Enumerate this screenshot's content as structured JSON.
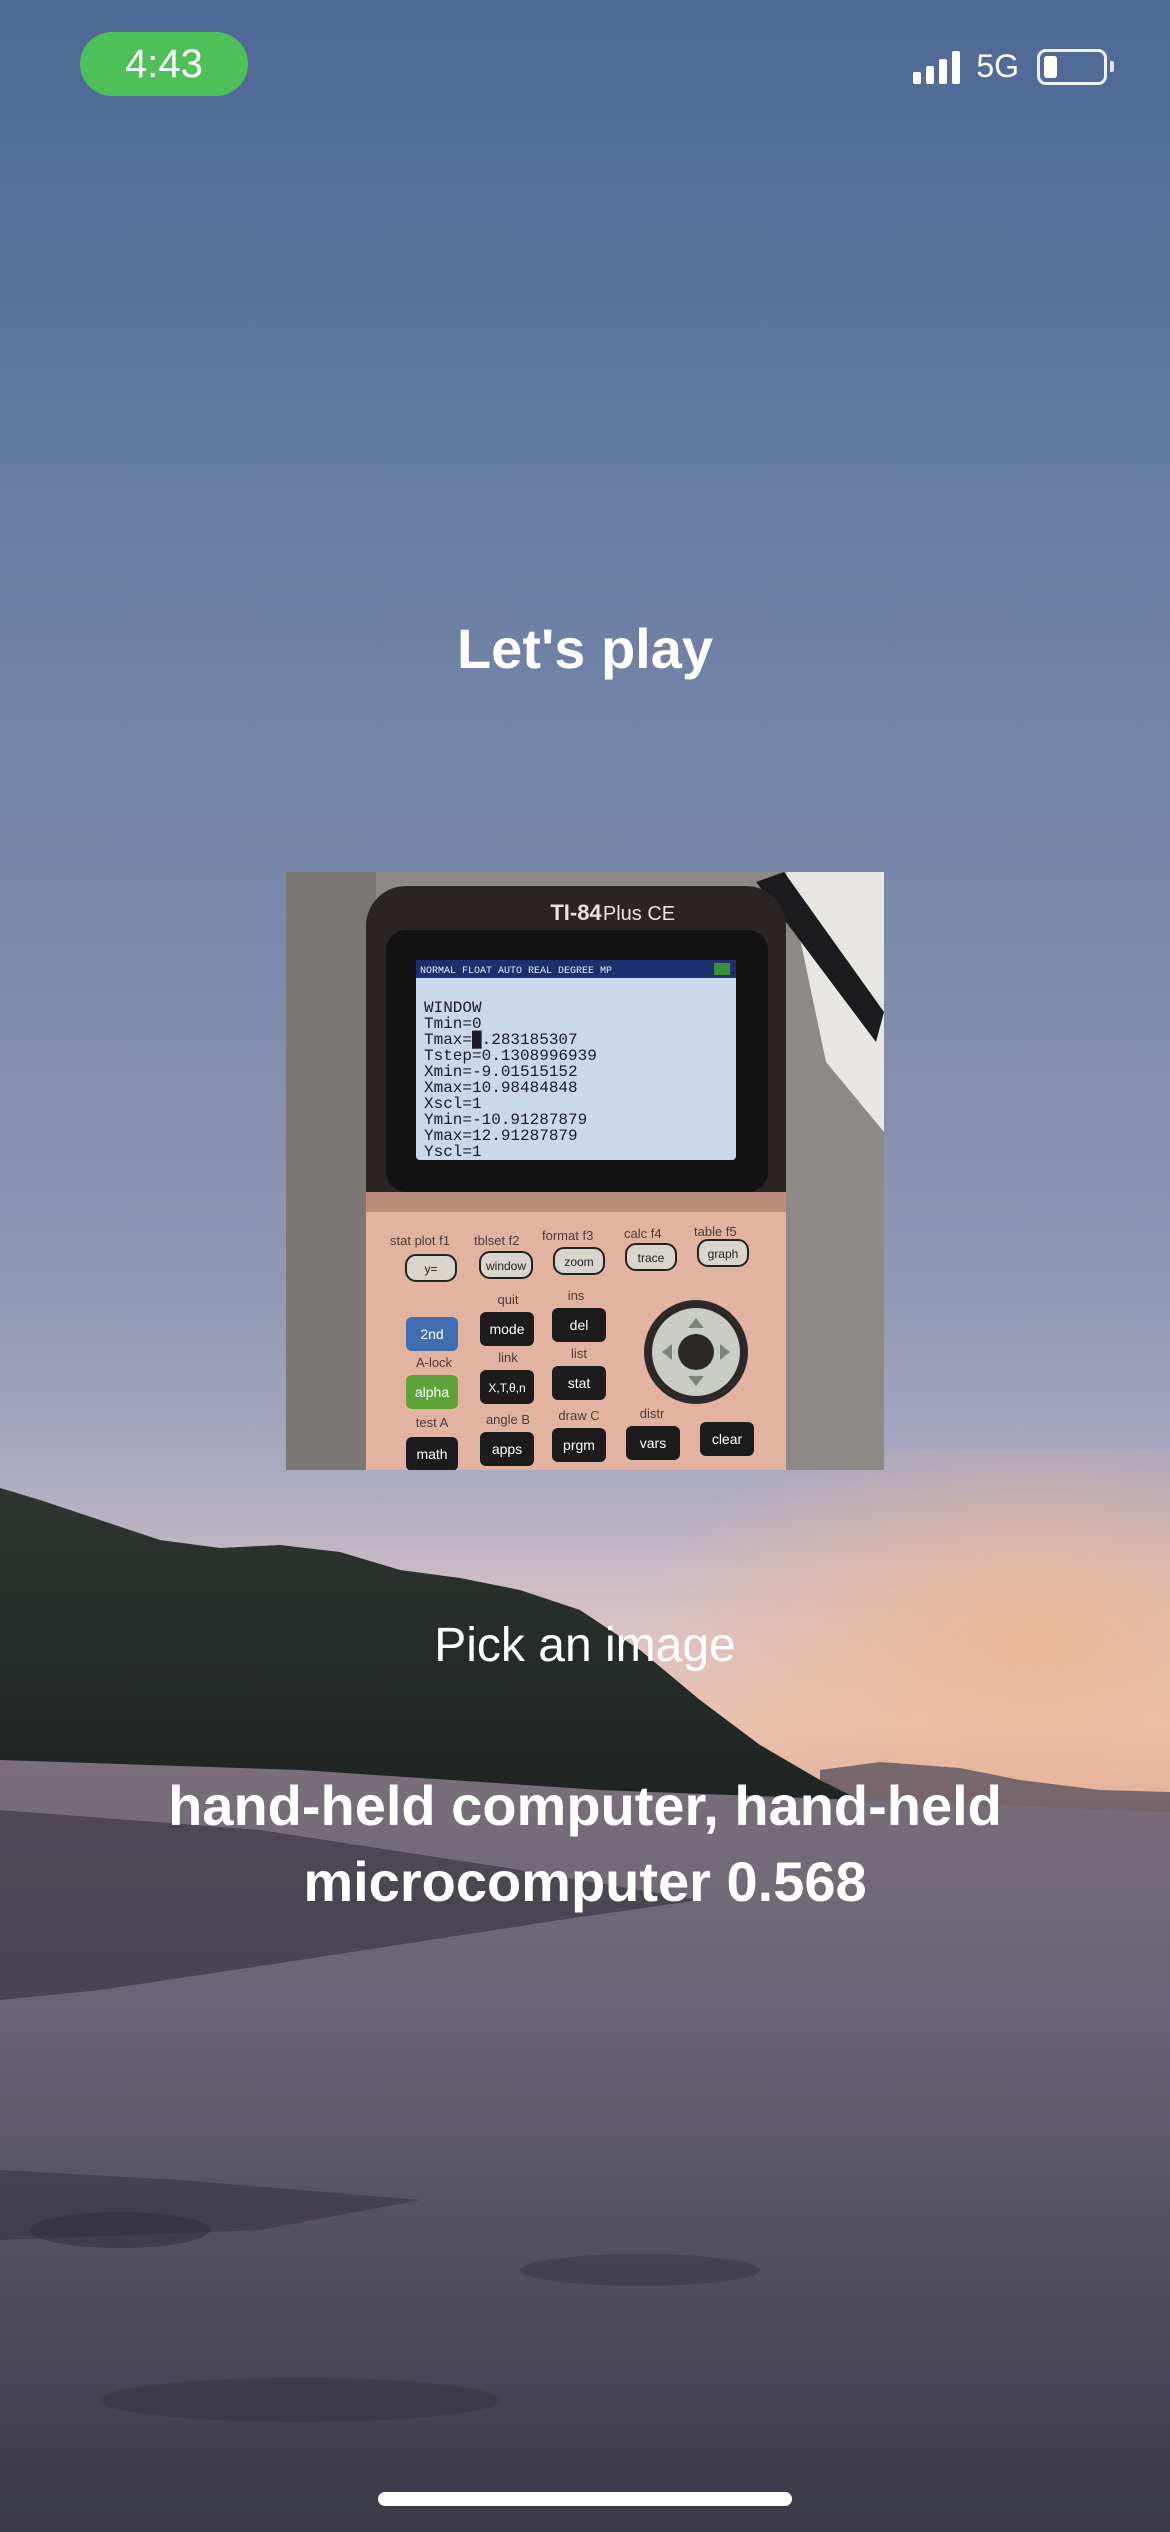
{
  "status_bar": {
    "time": "4:43",
    "network": "5G",
    "battery_level": 0.2,
    "signal_bars": 4
  },
  "main": {
    "heading": "Let's play",
    "pick_image_label": "Pick an image",
    "result_label": "hand-held computer, hand-held microcomputer",
    "result_score": "0.568"
  },
  "photo": {
    "brand": "TI-84",
    "model": "Plus CE",
    "screen_header": "NORMAL FLOAT AUTO REAL DEGREE MP",
    "screen_lines": [
      "WINDOW",
      " Tmin=0",
      " Tmax=█.283185307",
      " Tstep=0.1308996939",
      " Xmin=-9.01515152",
      " Xmax=10.98484848",
      " Xscl=1",
      " Ymin=-10.91287879",
      " Ymax=12.91287879",
      " Yscl=1"
    ],
    "f_labels": [
      "stat plot f1",
      "tblset f2",
      "format f3",
      "calc f4",
      "table f5"
    ],
    "top_keys": [
      "y=",
      "window",
      "zoom",
      "trace",
      "graph"
    ],
    "key_rows": [
      {
        "above": [
          "",
          "quit",
          "ins"
        ],
        "keys": [
          "2nd",
          "mode",
          "del"
        ]
      },
      {
        "above": [
          "A-lock",
          "link",
          "list"
        ],
        "keys": [
          "alpha",
          "X,T,θ,n",
          "stat"
        ]
      },
      {
        "above": [
          "test A",
          "angle B",
          "draw C",
          "distr"
        ],
        "keys": [
          "math",
          "apps",
          "prgm",
          "vars",
          "clear"
        ]
      }
    ]
  },
  "colors": {
    "time_pill": "#4fbf5a",
    "text": "#ffffff"
  }
}
